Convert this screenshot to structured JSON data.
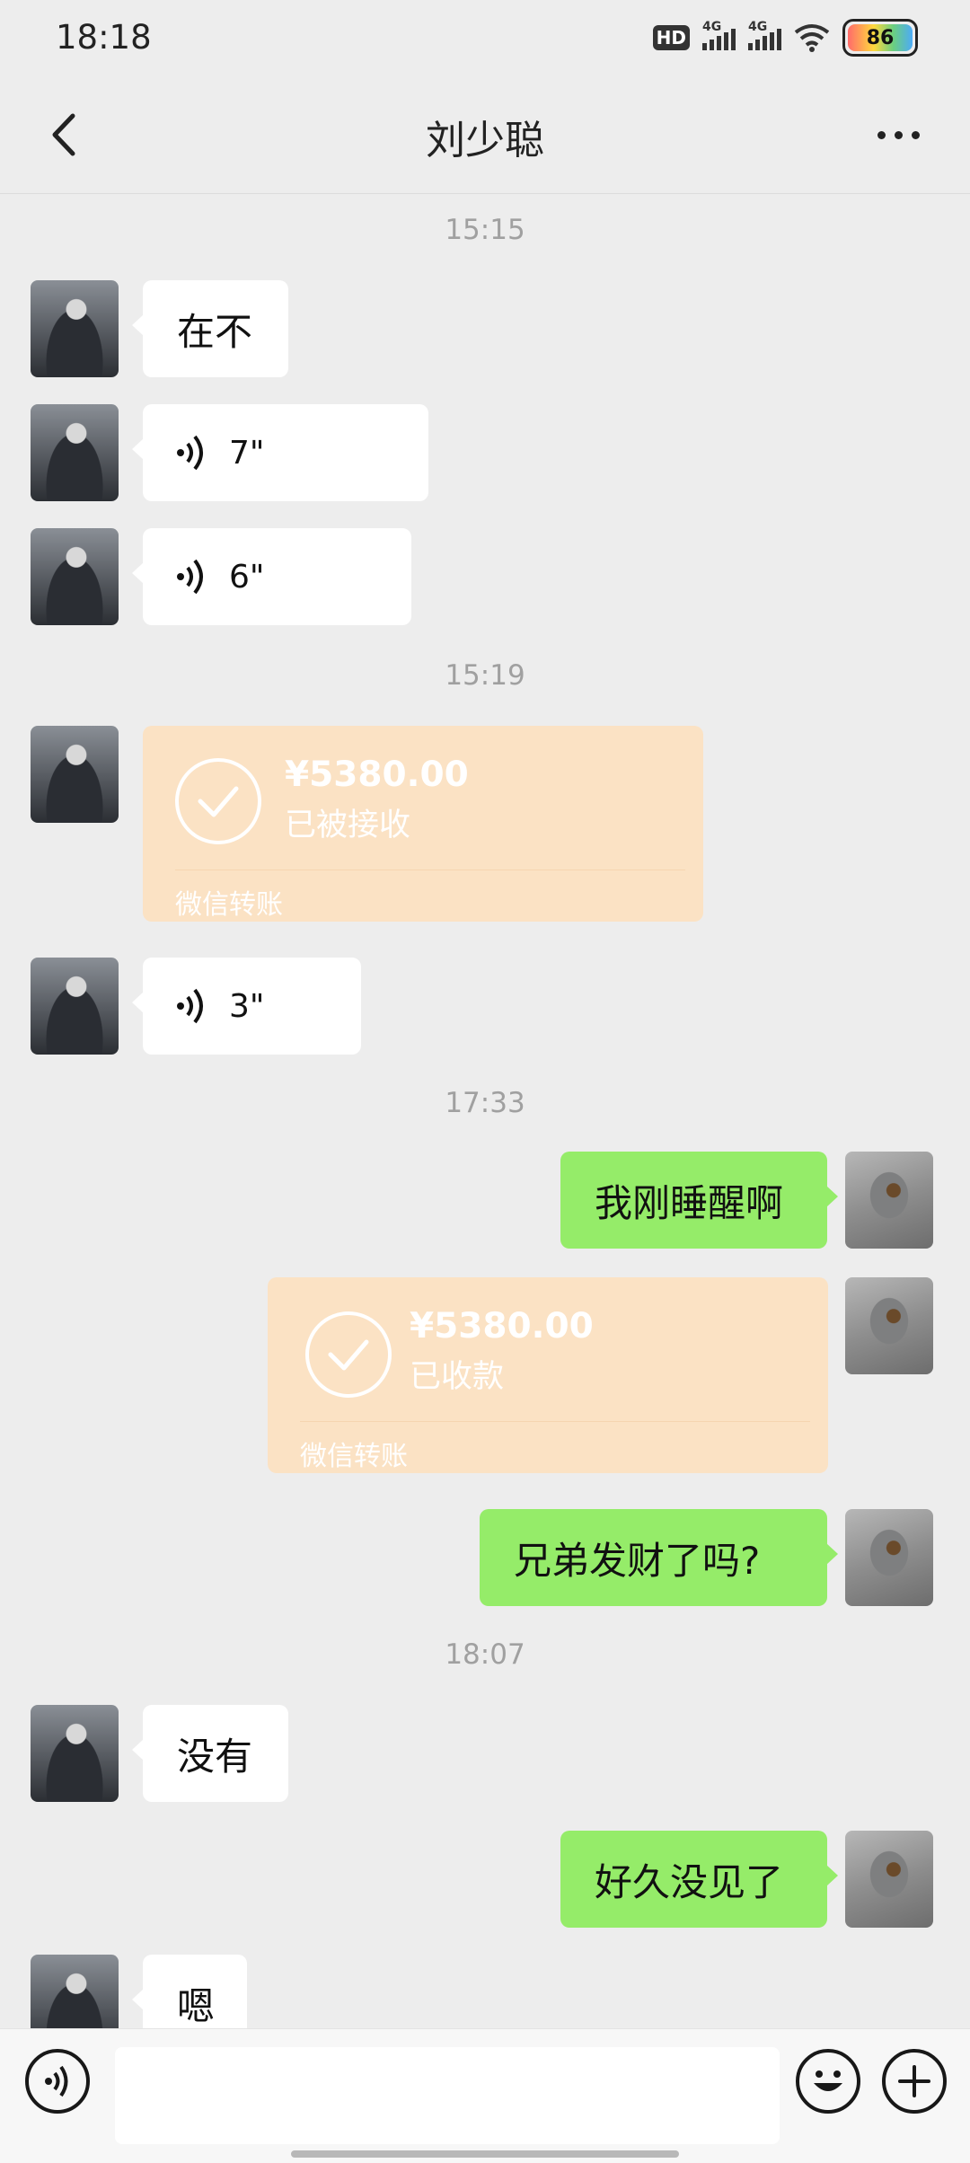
{
  "status_bar": {
    "time": "18:18",
    "hd_label": "HD",
    "net1": "4G",
    "net2": "4G",
    "battery": "86",
    "icons": [
      "hd-icon",
      "signal-4g-icon",
      "signal-4g-icon",
      "wifi-icon",
      "battery-icon"
    ]
  },
  "header": {
    "title": "刘少聪",
    "back_icon": "back-chevron-icon",
    "more_icon": "more-dots-icon"
  },
  "chat": {
    "timestamps": [
      "15:15",
      "15:19",
      "17:33",
      "18:07"
    ],
    "messages": [
      {
        "sender": "other",
        "type": "text",
        "text": "在不"
      },
      {
        "sender": "other",
        "type": "voice",
        "duration": "7\""
      },
      {
        "sender": "other",
        "type": "voice",
        "duration": "6\""
      },
      {
        "sender": "other",
        "type": "transfer",
        "amount": "¥5380.00",
        "status": "已被接收",
        "label": "微信转账"
      },
      {
        "sender": "other",
        "type": "voice",
        "duration": "3\""
      },
      {
        "sender": "self",
        "type": "text",
        "text": "我刚睡醒啊"
      },
      {
        "sender": "self",
        "type": "transfer",
        "amount": "¥5380.00",
        "status": "已收款",
        "label": "微信转账"
      },
      {
        "sender": "self",
        "type": "text",
        "text": "兄弟发财了吗?"
      },
      {
        "sender": "other",
        "type": "text",
        "text": "没有"
      },
      {
        "sender": "self",
        "type": "text",
        "text": "好久没见了"
      },
      {
        "sender": "other",
        "type": "text",
        "text": "嗯"
      }
    ]
  },
  "input_bar": {
    "voice_icon": "voice-input-icon",
    "text_value": "",
    "emoji_icon": "emoji-icon",
    "plus_icon": "plus-icon"
  },
  "colors": {
    "background": "#ededed",
    "incoming_bubble": "#ffffff",
    "outgoing_bubble": "#95ec69",
    "transfer_card": "#fbe2c4"
  }
}
